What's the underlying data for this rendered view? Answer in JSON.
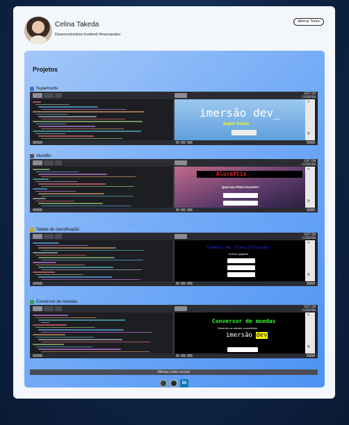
{
  "profile": {
    "name": "Celina Takeda",
    "bio": "Desenvolvedora frontend #imersaodev",
    "theme_button": "Alterar Tema"
  },
  "projects": {
    "heading": "Projetos",
    "items": [
      {
        "title": "Supertrunfo",
        "icon": "card-icon",
        "icon_color": "#3b6fd6",
        "preview_text": "imersão dev_",
        "preview_sub": "Super Trunfo",
        "preview_bg": "#6fb2e8"
      },
      {
        "title": "Aluraflix",
        "icon": "tv-icon",
        "icon_color": "#555555",
        "preview_text": "Aluraflix",
        "preview_sub": "Qual seu Filme Favorito?",
        "preview_bg": "#7b4a74"
      },
      {
        "title": "Tabela de classificação",
        "icon": "trophy-icon",
        "icon_color": "#d4a017",
        "preview_text": "Tabela de classificação",
        "preview_sub": "Inclua o jogador",
        "preview_bg": "#000000"
      },
      {
        "title": "Conversor de moedas",
        "icon": "coin-icon",
        "icon_color": "#3aa04a",
        "preview_text": "Conversor de moedas",
        "preview_sub": "Desenhe os valores convertidos",
        "preview_bg": "#000000"
      }
    ]
  },
  "embed": {
    "logo_line1": "EDIT ON",
    "logo_line2": "CODEPEN",
    "tabs": [
      "HTML",
      "CSS",
      "JS"
    ],
    "result_label": "Result"
  },
  "footer": {
    "social_label": "Minhas redes sociais",
    "links": [
      {
        "name": "github",
        "icon": "github-icon"
      },
      {
        "name": "reddit",
        "icon": "reddit-icon"
      },
      {
        "name": "linkedin",
        "icon": "linkedin-icon",
        "text": "in"
      }
    ]
  }
}
